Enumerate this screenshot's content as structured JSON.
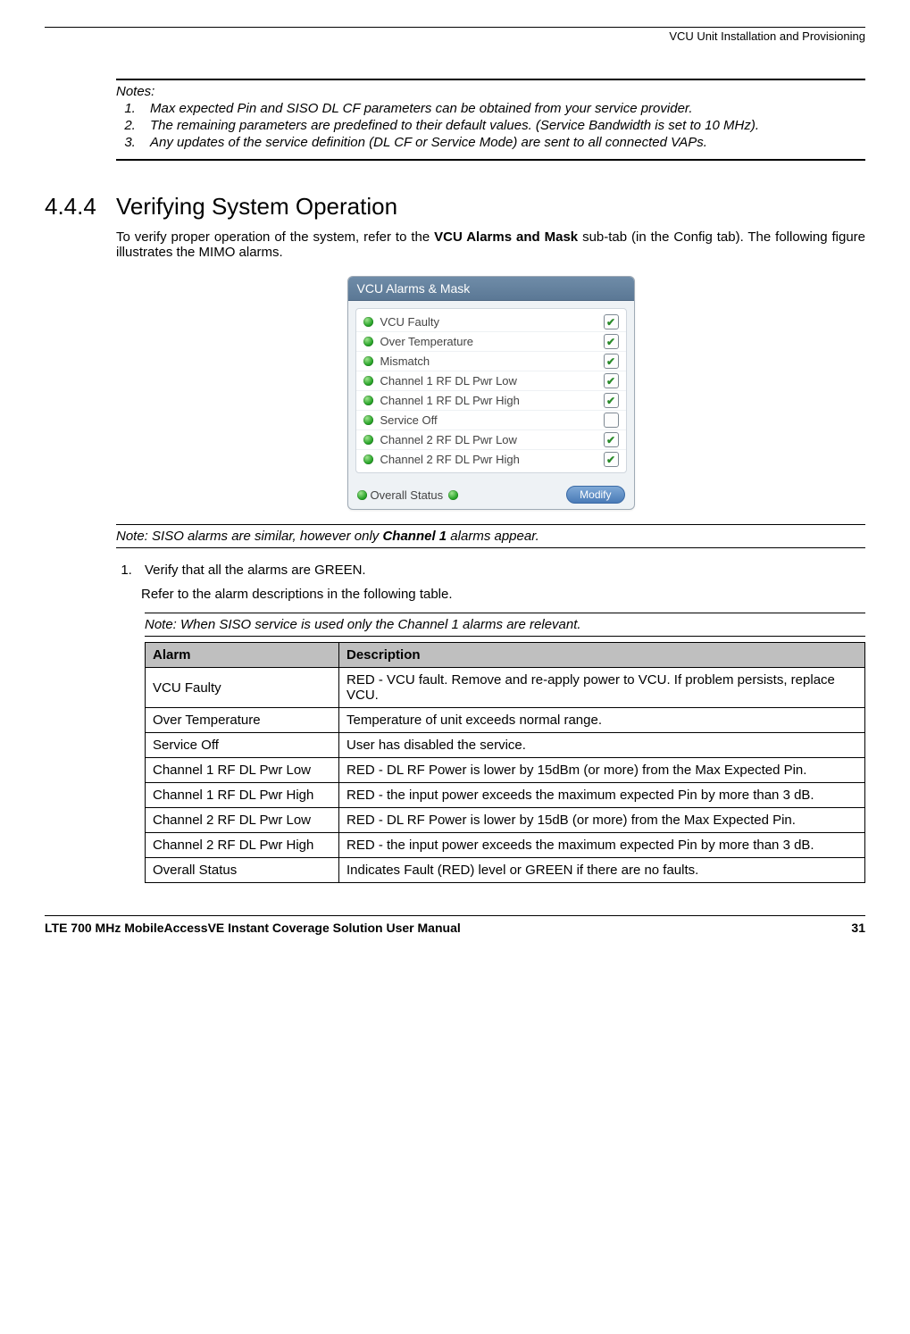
{
  "header": {
    "right": "VCU Unit Installation and Provisioning"
  },
  "notes": {
    "title": "Notes:",
    "items": [
      "Max expected Pin and SISO DL CF parameters can be obtained from your service provider.",
      "The remaining parameters are predefined to their default values. (Service Bandwidth is set to 10 MHz).",
      "Any updates of the service definition (DL CF or Service Mode) are sent to all connected VAPs."
    ]
  },
  "section": {
    "number": "4.4.4",
    "title": "Verifying System Operation",
    "intro_pre": "To verify proper operation of the system, refer to the ",
    "intro_bold": "VCU Alarms and Mask",
    "intro_post": " sub-tab (in the Config tab). The following figure illustrates the MIMO alarms."
  },
  "panel": {
    "title": "VCU Alarms & Mask",
    "alarms": [
      {
        "label": "VCU Faulty",
        "checked": true
      },
      {
        "label": "Over Temperature",
        "checked": true
      },
      {
        "label": "Mismatch",
        "checked": true
      },
      {
        "label": "Channel 1 RF DL Pwr Low",
        "checked": true
      },
      {
        "label": "Channel 1 RF DL Pwr High",
        "checked": true
      },
      {
        "label": "Service Off",
        "checked": false
      },
      {
        "label": "Channel 2 RF DL Pwr Low",
        "checked": true
      },
      {
        "label": "Channel 2 RF DL Pwr High",
        "checked": true
      }
    ],
    "overall_label": "Overall Status",
    "modify": "Modify"
  },
  "note1": {
    "pre": "Note: SISO alarms are similar, however only ",
    "bold": "Channel 1",
    "post": " alarms appear."
  },
  "steps": {
    "s1": "Verify that all the alarms are GREEN.",
    "s1_sub": "Refer to the alarm descriptions in the following table."
  },
  "note2": "Note: When SISO service is used only the Channel 1 alarms are relevant.",
  "table": {
    "headers": [
      "Alarm",
      "Description"
    ],
    "rows": [
      [
        "VCU Faulty",
        "RED - VCU fault. Remove and re-apply power to VCU. If problem persists, replace VCU."
      ],
      [
        "Over Temperature",
        "Temperature of unit exceeds normal range."
      ],
      [
        "Service Off",
        "User has disabled the service."
      ],
      [
        "Channel 1 RF DL Pwr Low",
        "RED - DL RF Power is lower by 15dBm (or more) from the Max Expected Pin."
      ],
      [
        "Channel 1 RF DL Pwr High",
        "RED - the input power exceeds the maximum expected Pin by more than 3 dB."
      ],
      [
        "Channel 2 RF DL Pwr Low",
        "RED - DL RF Power is lower by 15dB (or more) from the Max Expected Pin."
      ],
      [
        "Channel 2 RF DL Pwr High",
        "RED - the input power exceeds the maximum expected Pin by more than 3 dB."
      ],
      [
        "Overall Status",
        "Indicates Fault (RED) level or GREEN if there are no faults."
      ]
    ]
  },
  "footer": {
    "left": "LTE 700 MHz MobileAccessVE Instant Coverage Solution User Manual",
    "right": "31"
  }
}
